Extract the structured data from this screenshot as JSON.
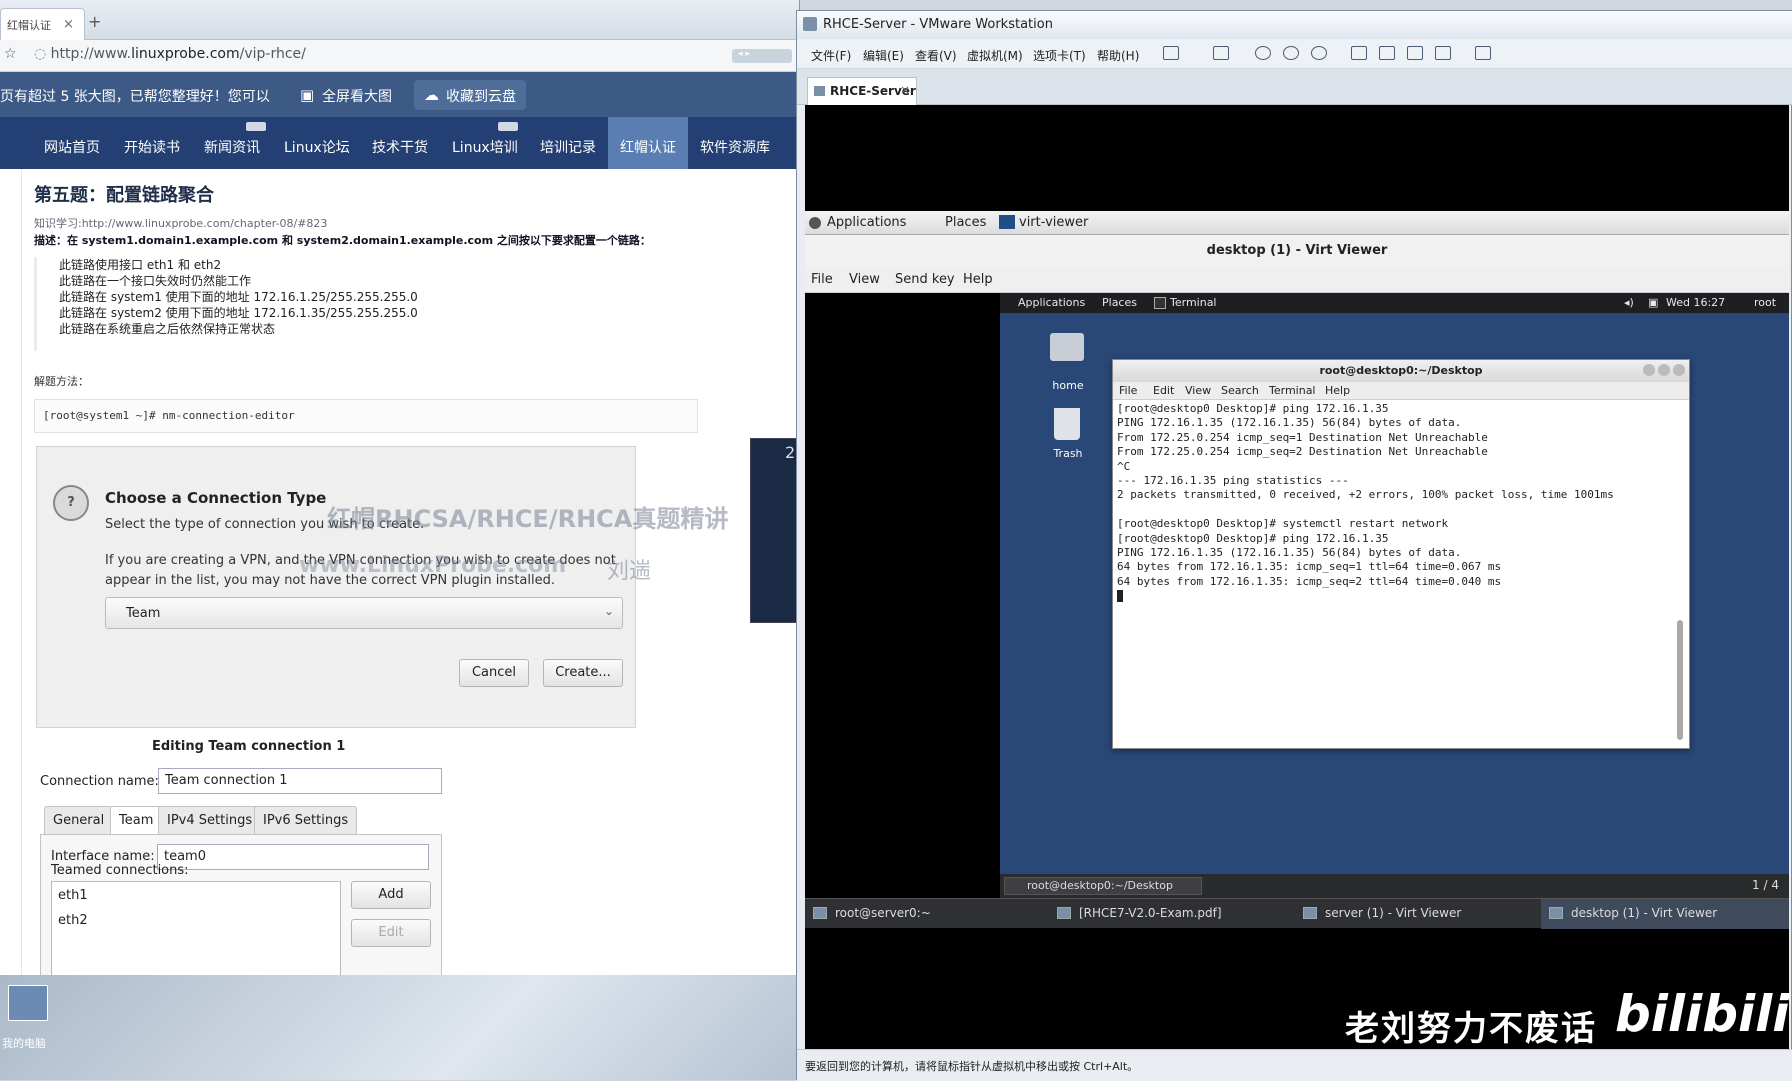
{
  "browser": {
    "tab": {
      "title": "红帽认证",
      "close": "×"
    },
    "new_tab": "+",
    "address": {
      "prefix": "http://www.",
      "host": "linuxprobe.com",
      "path": "/vip-rhce/"
    },
    "notice": {
      "text": "页有超过 5 张大图，已帮您整理好！您可以",
      "fullscreen_btn": "全屏看大图",
      "cloud_btn": "收藏到云盘"
    },
    "nav": [
      "网站首页",
      "开始读书",
      "新闻资讯",
      "Linux论坛",
      "技术干货",
      "Linux培训",
      "培训记录",
      "红帽认证",
      "软件资源库"
    ],
    "nav_active_index": 7,
    "article": {
      "title": "第五题：配置链路聚合",
      "link": "知识学习:http://www.linuxprobe.com/chapter-08/#823",
      "description": "描述：在 system1.domain1.example.com 和 system2.domain1.example.com 之间按以下要求配置一个链路：",
      "requirements": [
        "此链路使用接口 eth1 和 eth2",
        "此链路在一个接口失效时仍然能工作",
        "此链路在 system1 使用下面的地址 172.16.1.25/255.255.255.0",
        "此链路在 system2 使用下面的地址 172.16.1.35/255.255.255.0",
        "此链路在系统重启之后依然保持正常状态"
      ],
      "solution_label": "解题方法：",
      "command": "[root@system1 ~]# nm-connection-editor"
    },
    "dialog": {
      "title": "Choose a Connection Type",
      "subtitle": "Select the type of connection you wish to create.",
      "text": "If you are creating a VPN, and the VPN connection you wish to create does not appear in the list, you may not have the correct VPN plugin installed.",
      "selected_type": "Team",
      "cancel": "Cancel",
      "create": "Create..."
    },
    "watermark": {
      "line1": "红帽RHCSA/RHCE/RHCA真题精讲",
      "line2": "www.LinuxProbe.com",
      "author": "刘遄"
    },
    "editor": {
      "title": "Editing Team connection 1",
      "conn_name_label": "Connection name:",
      "conn_name_value": "Team connection 1",
      "tabs": [
        "General",
        "Team",
        "IPv4 Settings",
        "IPv6 Settings"
      ],
      "active_tab": "Team",
      "iface_label": "Interface name:",
      "iface_value": "team0",
      "teamed_label": "Teamed connections:",
      "teamed": [
        "eth1",
        "eth2"
      ],
      "add": "Add",
      "edit": "Edit"
    }
  },
  "desktop": {
    "icon_label": "我的电脑"
  },
  "side_window": {
    "number": "2"
  },
  "vmware": {
    "title": "RHCE-Server - VMware Workstation",
    "menu": [
      "文件(F)",
      "编辑(E)",
      "查看(V)",
      "虚拟机(M)",
      "选项卡(T)",
      "帮助(H)"
    ],
    "tab": "RHCE-Server",
    "status": "要返回到您的计算机，请将鼠标指针从虚拟机中移出或按 Ctrl+Alt。"
  },
  "guest_top": {
    "applications": "Applications",
    "places": "Places",
    "app": "virt-viewer"
  },
  "virt_viewer": {
    "title": "desktop (1) - Virt Viewer",
    "menu": [
      "File",
      "View",
      "Send key",
      "Help"
    ]
  },
  "inner": {
    "applications": "Applications",
    "places": "Places",
    "terminal": "Terminal",
    "clock": "Wed 16:27",
    "user": "root",
    "icons": [
      "home",
      "Trash"
    ],
    "terminal_window": {
      "title": "root@desktop0:~/Desktop",
      "menu": [
        "File",
        "Edit",
        "View",
        "Search",
        "Terminal",
        "Help"
      ],
      "lines": [
        "[root@desktop0 Desktop]# ping 172.16.1.35",
        "PING 172.16.1.35 (172.16.1.35) 56(84) bytes of data.",
        "From 172.25.0.254 icmp_seq=1 Destination Net Unreachable",
        "From 172.25.0.254 icmp_seq=2 Destination Net Unreachable",
        "^C",
        "--- 172.16.1.35 ping statistics ---",
        "2 packets transmitted, 0 received, +2 errors, 100% packet loss, time 1001ms",
        "",
        "[root@desktop0 Desktop]# systemctl restart network",
        "[root@desktop0 Desktop]# ping 172.16.1.35",
        "PING 172.16.1.35 (172.16.1.35) 56(84) bytes of data.",
        "64 bytes from 172.16.1.35: icmp_seq=1 ttl=64 time=0.067 ms",
        "64 bytes from 172.16.1.35: icmp_seq=2 ttl=64 time=0.040 ms"
      ]
    },
    "bottom_task": "root@desktop0:~/Desktop",
    "workspace": "1 / 4"
  },
  "host_taskbar": [
    "root@server0:~",
    "[RHCE7-V2.0-Exam.pdf]",
    "server (1) - Virt Viewer",
    "desktop (1) - Virt Viewer"
  ],
  "overlay": {
    "subtitle": "老刘努力不废话",
    "logo": "bilibili"
  }
}
